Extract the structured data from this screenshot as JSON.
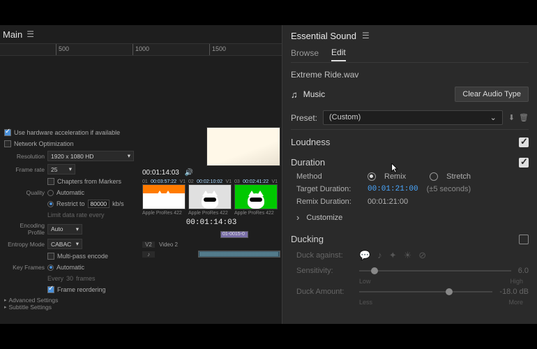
{
  "leftPanel": {
    "title": "Main",
    "ruler": {
      "ticks": [
        {
          "val": "500",
          "pos": 80
        },
        {
          "val": "1000",
          "pos": 190
        },
        {
          "val": "1500",
          "pos": 300
        }
      ]
    },
    "export": {
      "hwAccel": "Use hardware acceleration if available",
      "netOpt": "Network Optimization",
      "resolution": {
        "label": "Resolution",
        "value": "1920 x 1080 HD"
      },
      "frameRate": {
        "label": "Frame rate",
        "value": "25"
      },
      "chapters": "Chapters from Markers",
      "quality": {
        "label": "Quality",
        "auto": "Automatic",
        "restrict": "Restrict to",
        "val": "80000",
        "unit": "kb/s",
        "limit": "Limit data rate every"
      },
      "encProfile": {
        "label": "Encoding Profile",
        "value": "Auto"
      },
      "entropy": {
        "label": "Entropy Mode",
        "value": "CABAC"
      },
      "multipass": "Multi-pass encode",
      "keyFrames": {
        "label": "Key Frames",
        "auto": "Automatic",
        "every": "Every",
        "frames": "frames",
        "val": "30"
      },
      "reorder": "Frame reordering",
      "advanced": "Advanced Settings",
      "subtitle": "Subtitle Settings"
    },
    "preview": {
      "tc": "00:01:14:03",
      "thumbs": [
        {
          "seq": "01",
          "tc": "00:03:57:22",
          "v": "V1",
          "codec": "Apple ProRes 422"
        },
        {
          "seq": "02",
          "tc": "00:02:10:02",
          "v": "V1",
          "codec": "Apple ProRes 422"
        },
        {
          "seq": "03",
          "tc": "00:02:41:22",
          "v": "V1",
          "codec": "Apple ProRes 422"
        }
      ],
      "timeline": {
        "tc": "00:01:14:03",
        "v2": {
          "track": "V2",
          "name": "Video 2"
        },
        "clipName": "01-0015-0"
      }
    }
  },
  "essentialSound": {
    "title": "Essential Sound",
    "tabs": {
      "browse": "Browse",
      "edit": "Edit"
    },
    "fileName": "Extreme Ride.wav",
    "musicLabel": "Music",
    "clearBtn": "Clear Audio Type",
    "preset": {
      "label": "Preset:",
      "value": "(Custom)"
    },
    "loudness": {
      "title": "Loudness"
    },
    "duration": {
      "title": "Duration",
      "method": "Method",
      "remix": "Remix",
      "stretch": "Stretch",
      "targetLabel": "Target Duration:",
      "targetVal": "00:01:21:00",
      "tolerance": "(±5 seconds)",
      "remixLabel": "Remix Duration:",
      "remixVal": "00:01:21:00",
      "customize": "Customize"
    },
    "ducking": {
      "title": "Ducking",
      "against": "Duck against:",
      "sensitivity": {
        "label": "Sensitivity:",
        "value": "6.0",
        "low": "Low",
        "high": "High"
      },
      "amount": {
        "label": "Duck Amount:",
        "value": "-18.0 dB",
        "less": "Less",
        "more": "More"
      }
    }
  }
}
